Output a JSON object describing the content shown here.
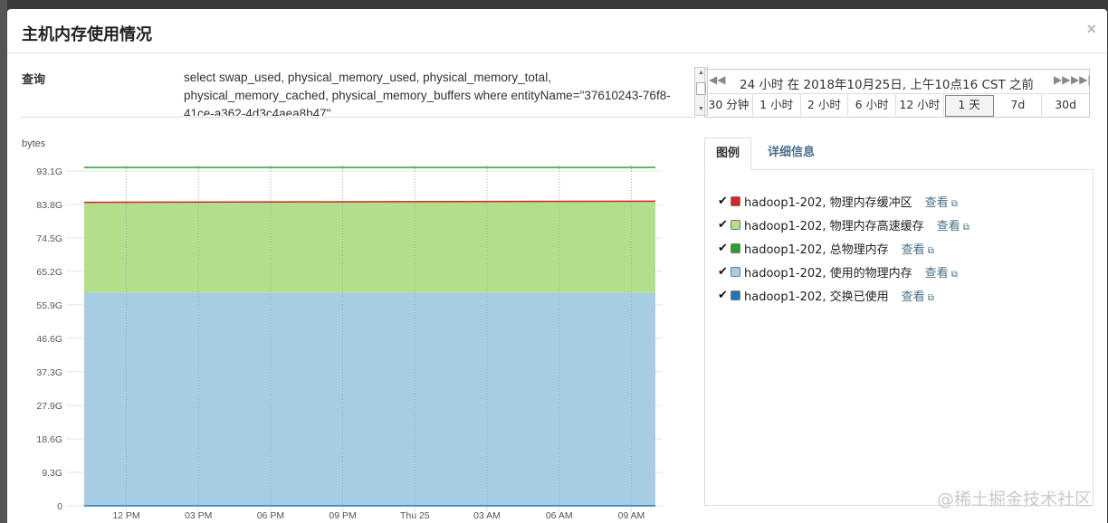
{
  "modal": {
    "title": "主机内存使用情况",
    "close_label": "×"
  },
  "query": {
    "label": "查询",
    "text": "select swap_used, physical_memory_used, physical_memory_total, physical_memory_cached, physical_memory_buffers where entityName=\"37610243-76f8-41ce-a362-4d3c4aea8b47\""
  },
  "time_range": {
    "label": "24 小时 在 2018年10月25日, 上午10点16 CST 之前",
    "nav_first": "◀◀",
    "nav_next": "▶▶",
    "nav_last": "▶▶|",
    "buttons": [
      "30 分钟",
      "1 小时",
      "2 小时",
      "6 小时",
      "12 小时",
      "1 天",
      "7d",
      "30d"
    ],
    "active": "1 天"
  },
  "tabs": {
    "legend": "图例",
    "details": "详细信息"
  },
  "legend": [
    {
      "label": "hadoop1-202, 物理内存缓冲区",
      "color": "#d62728",
      "checked": "✔",
      "link": "查看"
    },
    {
      "label": "hadoop1-202, 物理内存高速缓存",
      "color": "#b3de8c",
      "checked": "✔",
      "link": "查看"
    },
    {
      "label": "hadoop1-202, 总物理内存",
      "color": "#2ca02c",
      "checked": "✔",
      "link": "查看"
    },
    {
      "label": "hadoop1-202, 使用的物理内存",
      "color": "#a6cde3",
      "checked": "✔",
      "link": "查看"
    },
    {
      "label": "hadoop1-202, 交换已使用",
      "color": "#1f78b4",
      "checked": "✔",
      "link": "查看"
    }
  ],
  "watermark": "@稀土掘金技术社区",
  "chart_data": {
    "type": "area",
    "ylabel": "bytes",
    "y_ticks": [
      "0",
      "9.3G",
      "18.6G",
      "27.9G",
      "37.3G",
      "46.6G",
      "55.9G",
      "65.2G",
      "74.5G",
      "83.8G",
      "93.1G"
    ],
    "y_tick_values": [
      0,
      9.3,
      18.6,
      27.9,
      37.3,
      46.6,
      55.9,
      65.2,
      74.5,
      83.8,
      93.1
    ],
    "ylim": [
      0,
      93.1
    ],
    "x_ticks": [
      "12 PM",
      "03 PM",
      "06 PM",
      "09 PM",
      "Thu 25",
      "03 AM",
      "06 AM",
      "09 AM"
    ],
    "x_tick_hours": [
      1.75,
      4.75,
      7.75,
      10.75,
      13.75,
      16.75,
      19.75,
      22.75
    ],
    "xlim_hours": [
      0,
      23.75
    ],
    "series": [
      {
        "name": "hadoop1-202, 使用的物理内存",
        "type": "area",
        "color": "#a6cde3",
        "x": [
          0,
          23.75
        ],
        "values": [
          59.3,
          59.3
        ]
      },
      {
        "name": "hadoop1-202, 物理内存高速缓存",
        "type": "area",
        "color": "#b3de8c",
        "x": [
          0,
          23.75
        ],
        "values": [
          84.3,
          84.6
        ]
      },
      {
        "name": "hadoop1-202, 物理内存缓冲区",
        "type": "line",
        "color": "#d62728",
        "x": [
          0,
          23.75
        ],
        "values": [
          84.4,
          84.7
        ]
      },
      {
        "name": "hadoop1-202, 总物理内存",
        "type": "line",
        "color": "#2ca02c",
        "x": [
          0,
          23.75
        ],
        "values": [
          94.1,
          94.1
        ]
      },
      {
        "name": "hadoop1-202, 交换已使用",
        "type": "line",
        "color": "#1f78b4",
        "x": [
          0,
          23.75
        ],
        "values": [
          0,
          0
        ]
      }
    ]
  }
}
